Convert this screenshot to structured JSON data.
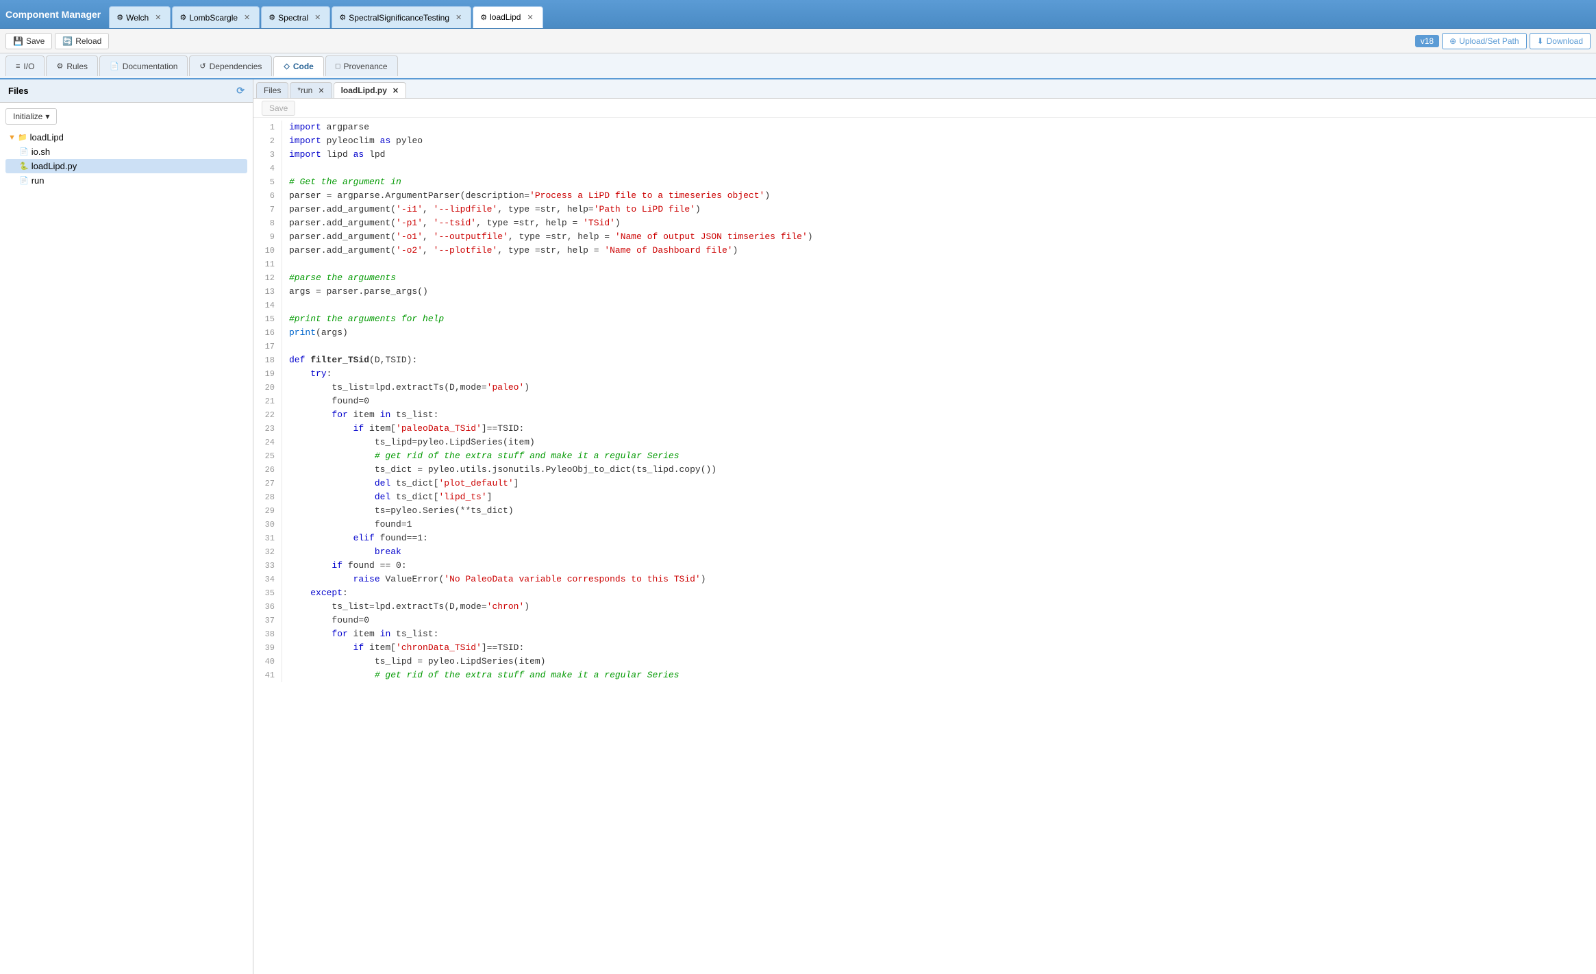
{
  "app": {
    "title": "Component Manager"
  },
  "tabs": [
    {
      "id": "welch",
      "label": "Welch",
      "icon": "⚙",
      "active": false,
      "closeable": true
    },
    {
      "id": "lombscargle",
      "label": "LombScargle",
      "icon": "⚙",
      "active": false,
      "closeable": true
    },
    {
      "id": "spectral",
      "label": "Spectral",
      "icon": "⚙",
      "active": false,
      "closeable": true
    },
    {
      "id": "spectralsig",
      "label": "SpectralSignificanceTesting",
      "icon": "⚙",
      "active": false,
      "closeable": true
    },
    {
      "id": "loadlipd",
      "label": "loadLipd",
      "icon": "⚙",
      "active": true,
      "closeable": true
    }
  ],
  "toolbar": {
    "save_label": "Save",
    "reload_label": "Reload",
    "version": "v18",
    "upload_label": "Upload/Set Path",
    "download_label": "Download"
  },
  "nav_tabs": [
    {
      "id": "io",
      "label": "I/O",
      "icon": "≡",
      "active": false
    },
    {
      "id": "rules",
      "label": "Rules",
      "icon": "⚙",
      "active": false
    },
    {
      "id": "documentation",
      "label": "Documentation",
      "icon": "📄",
      "active": false
    },
    {
      "id": "dependencies",
      "label": "Dependencies",
      "icon": "↺",
      "active": false
    },
    {
      "id": "code",
      "label": "Code",
      "icon": "◇",
      "active": true
    },
    {
      "id": "provenance",
      "label": "Provenance",
      "icon": "□",
      "active": false
    }
  ],
  "sidebar": {
    "title": "Files",
    "init_label": "Initialize",
    "tree": [
      {
        "id": "loadlipd-folder",
        "label": "loadLipd",
        "type": "folder",
        "indent": 0,
        "expanded": true
      },
      {
        "id": "io-sh",
        "label": "io.sh",
        "type": "file",
        "indent": 1
      },
      {
        "id": "loadlipd-py",
        "label": "loadLipd.py",
        "type": "file-py",
        "indent": 1,
        "selected": true
      },
      {
        "id": "run",
        "label": "run",
        "type": "file",
        "indent": 1
      }
    ]
  },
  "code_tabs": [
    {
      "id": "files",
      "label": "Files",
      "active": false,
      "closeable": false
    },
    {
      "id": "run",
      "label": "*run",
      "active": false,
      "closeable": true
    },
    {
      "id": "loadlipd-py",
      "label": "loadLipd.py",
      "active": true,
      "closeable": true
    }
  ],
  "code_toolbar": {
    "save_label": "Save"
  },
  "code_lines": [
    {
      "num": 1,
      "html": "<span class='kw'>import</span> argparse"
    },
    {
      "num": 2,
      "html": "<span class='kw'>import</span> pyleoclim <span class='kw'>as</span> pyleo"
    },
    {
      "num": 3,
      "html": "<span class='kw'>import</span> lipd <span class='kw'>as</span> lpd"
    },
    {
      "num": 4,
      "html": ""
    },
    {
      "num": 5,
      "html": "<span class='comment'># Get the argument in</span>"
    },
    {
      "num": 6,
      "html": "parser = argparse.ArgumentParser(description=<span class='str'>'Process a LiPD file to a timeseries object'</span>)"
    },
    {
      "num": 7,
      "html": "parser.add_argument(<span class='str'>'-i1'</span>, <span class='str'>'--lipdfile'</span>, type =str, help=<span class='str'>'Path to LiPD file'</span>)"
    },
    {
      "num": 8,
      "html": "parser.add_argument(<span class='str'>'-p1'</span>, <span class='str'>'--tsid'</span>, type =str, help = <span class='str'>'TSid'</span>)"
    },
    {
      "num": 9,
      "html": "parser.add_argument(<span class='str'>'-o1'</span>, <span class='str'>'--outputfile'</span>, type =str, help = <span class='str'>'Name of output JSON timseries file'</span>)"
    },
    {
      "num": 10,
      "html": "parser.add_argument(<span class='str'>'-o2'</span>, <span class='str'>'--plotfile'</span>, type =str, help = <span class='str'>'Name of Dashboard file'</span>)"
    },
    {
      "num": 11,
      "html": ""
    },
    {
      "num": 12,
      "html": "<span class='comment'>#parse the arguments</span>"
    },
    {
      "num": 13,
      "html": "args = parser.parse_args()"
    },
    {
      "num": 14,
      "html": ""
    },
    {
      "num": 15,
      "html": "<span class='comment'>#print the arguments for help</span>"
    },
    {
      "num": 16,
      "html": "<span class='builtin'>print</span>(args)"
    },
    {
      "num": 17,
      "html": ""
    },
    {
      "num": 18,
      "html": "<span class='kw'>def</span> <span class='def-name'>filter_TSid</span>(D,TSID):"
    },
    {
      "num": 19,
      "html": "    <span class='kw'>try</span>:"
    },
    {
      "num": 20,
      "html": "        ts_list=lpd.extractTs(D,mode=<span class='str'>'paleo'</span>)"
    },
    {
      "num": 21,
      "html": "        found=0"
    },
    {
      "num": 22,
      "html": "        <span class='kw'>for</span> item <span class='kw'>in</span> ts_list:"
    },
    {
      "num": 23,
      "html": "            <span class='kw'>if</span> item[<span class='str'>'paleoData_TSid'</span>]==TSID:"
    },
    {
      "num": 24,
      "html": "                ts_lipd=pyleo.LipdSeries(item)"
    },
    {
      "num": 25,
      "html": "                <span class='comment'># get rid of the extra stuff and make it a regular Series</span>"
    },
    {
      "num": 26,
      "html": "                ts_dict = pyleo.utils.jsonutils.PyleoObj_to_dict(ts_lipd.copy())"
    },
    {
      "num": 27,
      "html": "                <span class='kw'>del</span> ts_dict[<span class='str'>'plot_default'</span>]"
    },
    {
      "num": 28,
      "html": "                <span class='kw'>del</span> ts_dict[<span class='str'>'lipd_ts'</span>]"
    },
    {
      "num": 29,
      "html": "                ts=pyleo.Series(**ts_dict)"
    },
    {
      "num": 30,
      "html": "                found=1"
    },
    {
      "num": 31,
      "html": "            <span class='kw'>elif</span> found==1:"
    },
    {
      "num": 32,
      "html": "                <span class='kw'>break</span>"
    },
    {
      "num": 33,
      "html": "        <span class='kw'>if</span> found == 0:"
    },
    {
      "num": 34,
      "html": "            <span class='kw'>raise</span> ValueError(<span class='str'>'No PaleoData variable corresponds to this TSid'</span>)"
    },
    {
      "num": 35,
      "html": "    <span class='kw'>except</span>:"
    },
    {
      "num": 36,
      "html": "        ts_list=lpd.extractTs(D,mode=<span class='str'>'chron'</span>)"
    },
    {
      "num": 37,
      "html": "        found=0"
    },
    {
      "num": 38,
      "html": "        <span class='kw'>for</span> item <span class='kw'>in</span> ts_list:"
    },
    {
      "num": 39,
      "html": "            <span class='kw'>if</span> item[<span class='str'>'chronData_TSid'</span>]==TSID:"
    },
    {
      "num": 40,
      "html": "                ts_lipd = pyleo.LipdSeries(item)"
    },
    {
      "num": 41,
      "html": "                <span class='comment'># get rid of the extra stuff and make it a regular Series</span>"
    }
  ]
}
